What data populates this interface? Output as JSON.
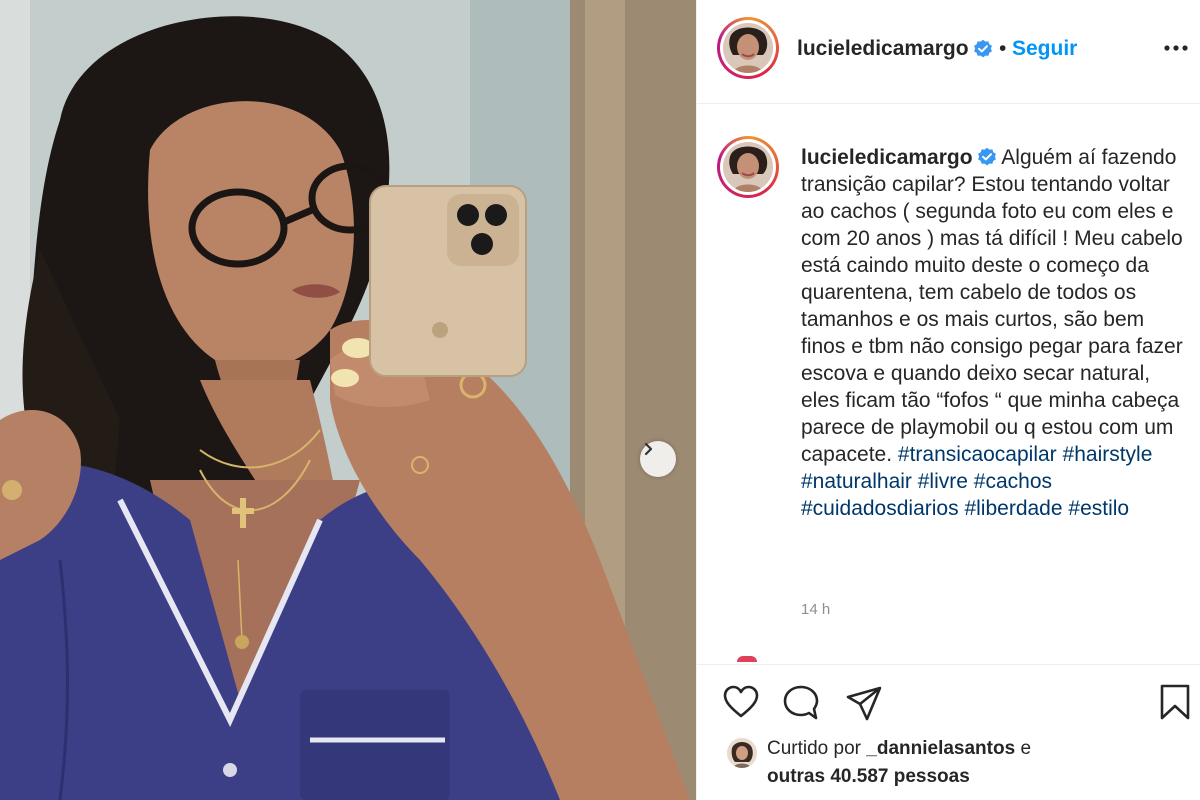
{
  "post": {
    "username": "lucieledicamargo",
    "follow_label": "Seguir",
    "separator": "•",
    "verified_color": "#3897f0",
    "follow_color": "#0095f6"
  },
  "caption": {
    "username": "lucieledicamargo",
    "text": "Alguém aí fazendo transição capilar? Estou tentando voltar ao cachos ( segunda foto eu com eles e com 20 anos ) mas tá difícil ! Meu cabelo está caindo muito deste o começo da quarentena, tem cabelo de todos os tamanhos e os mais curtos, são bem finos e tbm não consigo pegar para fazer escova e quando deixo secar natural, eles ficam tão “fofos “ que minha cabeça parece de playmobil ou q estou com um capacete.",
    "hashtags": [
      "#transicaocapilar",
      "#hairstyle",
      "#naturalhair",
      "#livre",
      "#cachos",
      "#cuidadosdiarios",
      "#liberdade",
      "#estilo"
    ],
    "time_ago": "14 h"
  },
  "likes": {
    "prefix": "Curtido por",
    "user": "_dannielasantos",
    "connector": "e",
    "others": "outras 40.587 pessoas"
  },
  "icons": {
    "more": "more-options-icon",
    "like": "heart-icon",
    "comment": "comment-icon",
    "share": "share-icon",
    "save": "bookmark-icon",
    "next": "chevron-right-icon",
    "verified": "verified-badge-icon"
  }
}
